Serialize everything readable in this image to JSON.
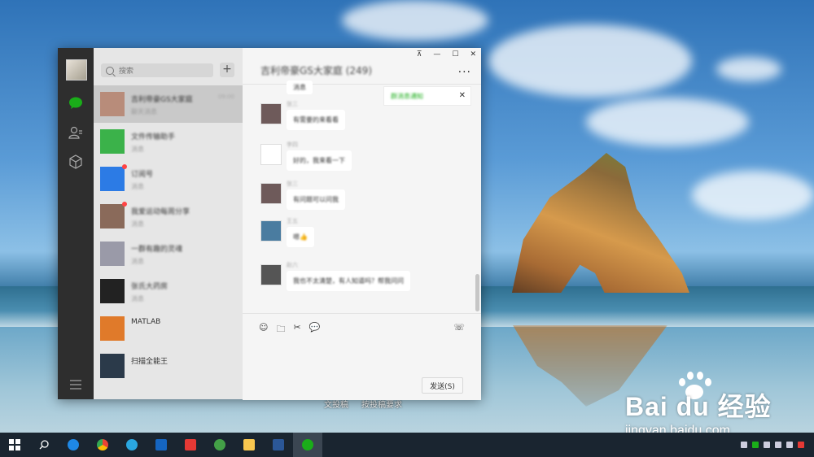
{
  "desktop": {
    "labels": [
      "文投稿",
      "按投稿要求"
    ],
    "watermark": {
      "main": "Bai du 经验",
      "sub": "jingyan.baidu.com"
    }
  },
  "app": {
    "nav": {
      "icons": [
        "avatar",
        "chat-icon",
        "contacts-icon",
        "favorites-icon",
        "menu-icon"
      ],
      "accent_color": "#1aad19"
    },
    "search": {
      "placeholder": "搜索"
    },
    "add_label": "+",
    "conversations": [
      {
        "name": "吉利帝豪GS大家庭",
        "preview": "聊天消息",
        "time": "09:00",
        "selected": true,
        "unread": false,
        "avatar_color": "#b88c7a"
      },
      {
        "name": "文件传输助手",
        "preview": "消息",
        "time": "",
        "selected": false,
        "unread": false,
        "avatar_color": "#3bb24a"
      },
      {
        "name": "订阅号",
        "preview": "消息",
        "time": "",
        "selected": false,
        "unread": true,
        "avatar_color": "#2c7be5"
      },
      {
        "name": "我爱运动每周分享",
        "preview": "消息",
        "time": "",
        "selected": false,
        "unread": true,
        "avatar_color": "#8a6a5a"
      },
      {
        "name": "一群有趣的灵魂",
        "preview": "消息",
        "time": "",
        "selected": false,
        "unread": false,
        "avatar_color": "#9a9aa8"
      },
      {
        "name": "张氏大药房",
        "preview": "消息",
        "time": "",
        "selected": false,
        "unread": false,
        "avatar_color": "#222222"
      },
      {
        "name": "MATLAB",
        "preview": "",
        "time": "",
        "selected": false,
        "unread": false,
        "avatar_color": "#e07a2a"
      },
      {
        "name": "扫描全能王",
        "preview": "",
        "time": "",
        "selected": false,
        "unread": false,
        "avatar_color": "#2b3a4a"
      }
    ],
    "chat": {
      "title": "吉利帝豪GS大家庭 (249)",
      "window_buttons": [
        "⊼",
        "—",
        "☐",
        "✕"
      ],
      "more": "···",
      "notice": {
        "text": "群消息通知",
        "close": "✕"
      },
      "messages": [
        {
          "sender": "",
          "text": "消息",
          "avatar_color": "#6e5a5a"
        },
        {
          "sender": "张三",
          "text": "有需要的来看看",
          "avatar_color": "#6e5a5a"
        },
        {
          "sender": "李四",
          "text": "好的，我来看一下",
          "avatar_color": "#ffffff"
        },
        {
          "sender": "张三",
          "text": "有问题可以问我",
          "avatar_color": "#6e5a5a"
        },
        {
          "sender": "王五",
          "text": "嗯👍",
          "avatar_color": "#4a7ca0"
        },
        {
          "sender": "赵六",
          "text": "我也不太清楚，有人知道吗？帮我问问",
          "avatar_color": "#555555"
        }
      ],
      "toolbar_icons": [
        "☺",
        "🗀",
        "✂",
        "💬"
      ],
      "call_icon": "☏",
      "send_label": "发送(S)"
    }
  },
  "taskbar": {
    "apps": [
      "start",
      "search",
      "edge",
      "chrome",
      "ie",
      "app",
      "app",
      "app",
      "explorer",
      "word",
      "wechat"
    ],
    "clock": {
      "time": "",
      "date": ""
    }
  }
}
